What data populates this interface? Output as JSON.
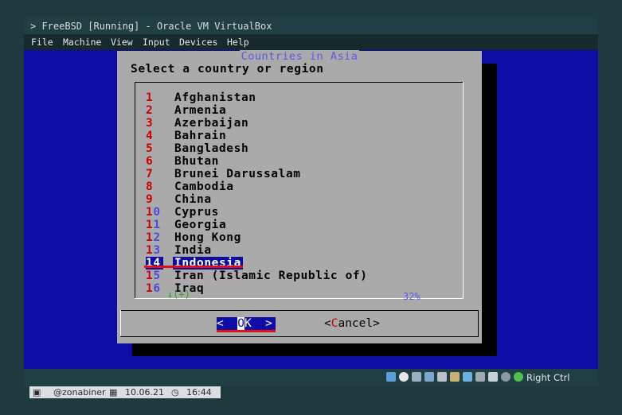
{
  "window": {
    "title": "> FreeBSD [Running] - Oracle VM VirtualBox",
    "menu": [
      "File",
      "Machine",
      "View",
      "Input",
      "Devices",
      "Help"
    ],
    "host_key_label": "Right Ctrl",
    "status_icons": [
      "hard-disk-icon",
      "optical-drive-icon",
      "audio-icon",
      "network-icon",
      "usb-icon",
      "shared-folder-icon",
      "display-icon",
      "recording-icon",
      "virtualization-icon",
      "mouse-icon",
      "keyboard-icon"
    ]
  },
  "dialog": {
    "title": "Countries in Asia",
    "prompt": "Select a country or region",
    "items": [
      {
        "num": "1",
        "name": "Afghanistan"
      },
      {
        "num": "2",
        "name": "Armenia"
      },
      {
        "num": "3",
        "name": "Azerbaijan"
      },
      {
        "num": "4",
        "name": "Bahrain"
      },
      {
        "num": "5",
        "name": "Bangladesh"
      },
      {
        "num": "6",
        "name": "Bhutan"
      },
      {
        "num": "7",
        "name": "Brunei Darussalam"
      },
      {
        "num": "8",
        "name": "Cambodia"
      },
      {
        "num": "9",
        "name": "China"
      },
      {
        "num": "10",
        "name": "Cyprus"
      },
      {
        "num": "11",
        "name": "Georgia"
      },
      {
        "num": "12",
        "name": "Hong Kong"
      },
      {
        "num": "13",
        "name": "India"
      },
      {
        "num": "14",
        "name": "Indonesia"
      },
      {
        "num": "15",
        "name": "Iran (Islamic Republic of)"
      },
      {
        "num": "16",
        "name": "Iraq"
      }
    ],
    "selected_index": 13,
    "more_indicator": "↓(+)",
    "scroll_percent": "32%",
    "ok_button": {
      "left": "<  ",
      "hot": "O",
      "rest": "K  >"
    },
    "cancel_button": {
      "left": "<",
      "hot": "C",
      "rest": "ancel>"
    }
  },
  "footer": {
    "user": "@zonabiner",
    "date": "10.06.21",
    "time": "16:44"
  },
  "colors": {
    "console_blue": "#0d0da6",
    "dialog_gray": "#aaaaaa",
    "hotkey_red": "#cc0000",
    "annotation_red": "#e01010"
  }
}
